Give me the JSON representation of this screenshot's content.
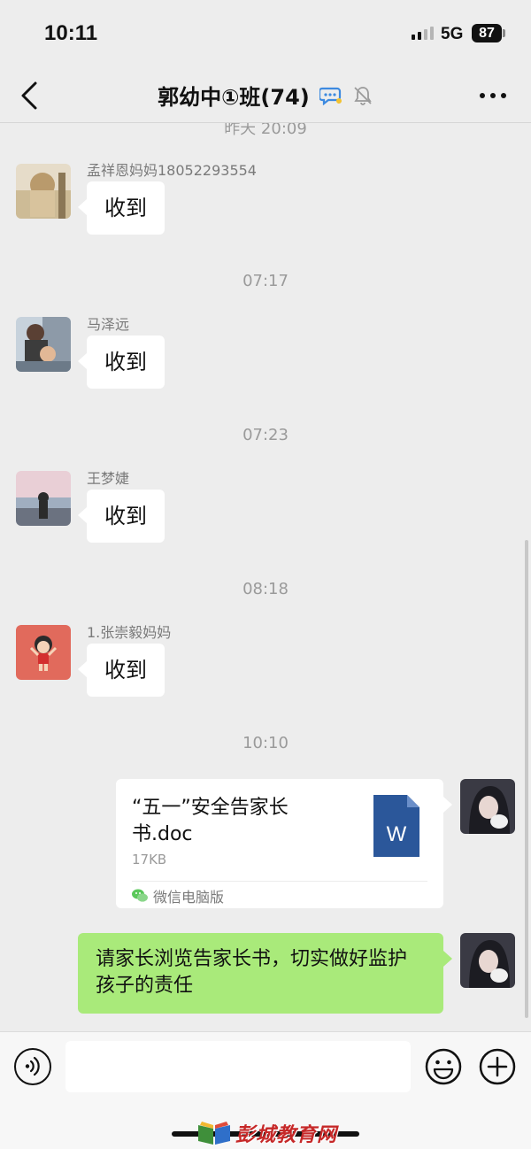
{
  "status_bar": {
    "time": "10:11",
    "network": "5G",
    "battery": "87"
  },
  "nav": {
    "title": "郭幼中①班(74)"
  },
  "messages": [
    {
      "type": "timestamp",
      "text": "昨天 20:09"
    },
    {
      "type": "incoming",
      "sender": "孟祥恩妈妈18052293554",
      "text": "收到"
    },
    {
      "type": "timestamp",
      "text": "07:17"
    },
    {
      "type": "incoming",
      "sender": "马泽远",
      "text": "收到"
    },
    {
      "type": "timestamp",
      "text": "07:23"
    },
    {
      "type": "incoming",
      "sender": "王梦婕",
      "text": "收到"
    },
    {
      "type": "timestamp",
      "text": "08:18"
    },
    {
      "type": "incoming",
      "sender": "1.张崇毅妈妈",
      "text": "收到"
    },
    {
      "type": "timestamp",
      "text": "10:10"
    },
    {
      "type": "outgoing_file",
      "file_name": "“五一”安全告家长书.doc",
      "file_size": "17KB",
      "source": "微信电脑版",
      "file_icon_letter": "W"
    },
    {
      "type": "outgoing",
      "text": "请家长浏览告家长书，切实做好监护孩子的责任"
    }
  ],
  "input": {
    "placeholder": ""
  },
  "watermark": "彭城教育网",
  "colors": {
    "background": "#ededed",
    "outgoing_bubble": "#a9ea7a",
    "incoming_bubble": "#ffffff",
    "word_blue": "#2b579a"
  },
  "icons": [
    "back-arrow-icon",
    "group-chat-icon",
    "mute-bell-icon",
    "more-dots-icon",
    "voice-icon",
    "emoji-icon",
    "plus-icon",
    "word-file-icon",
    "wechat-pc-icon"
  ]
}
